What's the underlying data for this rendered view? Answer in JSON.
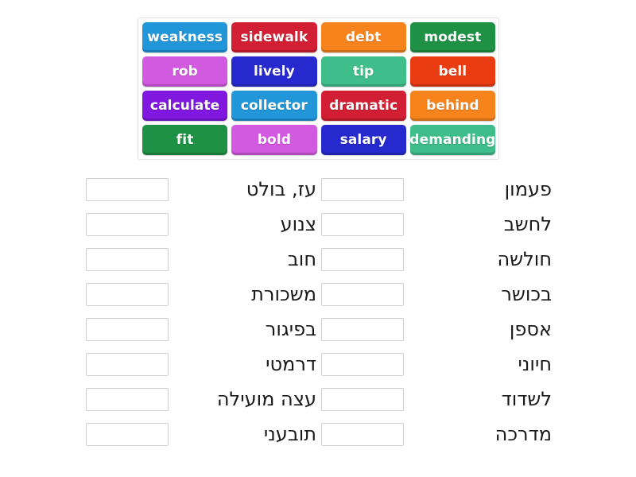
{
  "tile_bank": {
    "name": "word-tile-bank",
    "rows": [
      [
        {
          "label": "weakness",
          "color": "#2196d9"
        },
        {
          "label": "sidewalk",
          "color": "#d21f33"
        },
        {
          "label": "debt",
          "color": "#f7831d"
        },
        {
          "label": "modest",
          "color": "#1e9145"
        }
      ],
      [
        {
          "label": "rob",
          "color": "#d25ae0"
        },
        {
          "label": "lively",
          "color": "#2629cd"
        },
        {
          "label": "tip",
          "color": "#3fbd8b"
        },
        {
          "label": "bell",
          "color": "#ea3c12"
        }
      ],
      [
        {
          "label": "calculate",
          "color": "#8118e0"
        },
        {
          "label": "collector",
          "color": "#2196d9"
        },
        {
          "label": "dramatic",
          "color": "#d21f33"
        },
        {
          "label": "behind",
          "color": "#f7831d"
        }
      ],
      [
        {
          "label": "fit",
          "color": "#1e9145"
        },
        {
          "label": "bold",
          "color": "#d25ae0"
        },
        {
          "label": "salary",
          "color": "#2629cd"
        },
        {
          "label": "demanding",
          "color": "#3fbd8b"
        }
      ]
    ]
  },
  "answers": {
    "left_column": [
      {
        "input_value": "",
        "label": "עז, בולט"
      },
      {
        "input_value": "",
        "label": "צנוע"
      },
      {
        "input_value": "",
        "label": "חוב"
      },
      {
        "input_value": "",
        "label": "משכורת"
      },
      {
        "input_value": "",
        "label": "בפיגור"
      },
      {
        "input_value": "",
        "label": "דרמטי"
      },
      {
        "input_value": "",
        "label": "עצה מועילה"
      },
      {
        "input_value": "",
        "label": "תובעני"
      }
    ],
    "right_column": [
      {
        "input_value": "",
        "label": "פעמון"
      },
      {
        "input_value": "",
        "label": "לחשב"
      },
      {
        "input_value": "",
        "label": "חולשה"
      },
      {
        "input_value": "",
        "label": "בכושר"
      },
      {
        "input_value": "",
        "label": "אספן"
      },
      {
        "input_value": "",
        "label": "חיוני"
      },
      {
        "input_value": "",
        "label": "לשדוד"
      },
      {
        "input_value": "",
        "label": "מדרכה"
      }
    ]
  },
  "colors": {
    "page_background": "#ffffff",
    "bank_border": "#e2e2e2",
    "input_border": "#cfcfcf",
    "text": "#1a1a1a",
    "tile_text": "#ffffff"
  }
}
